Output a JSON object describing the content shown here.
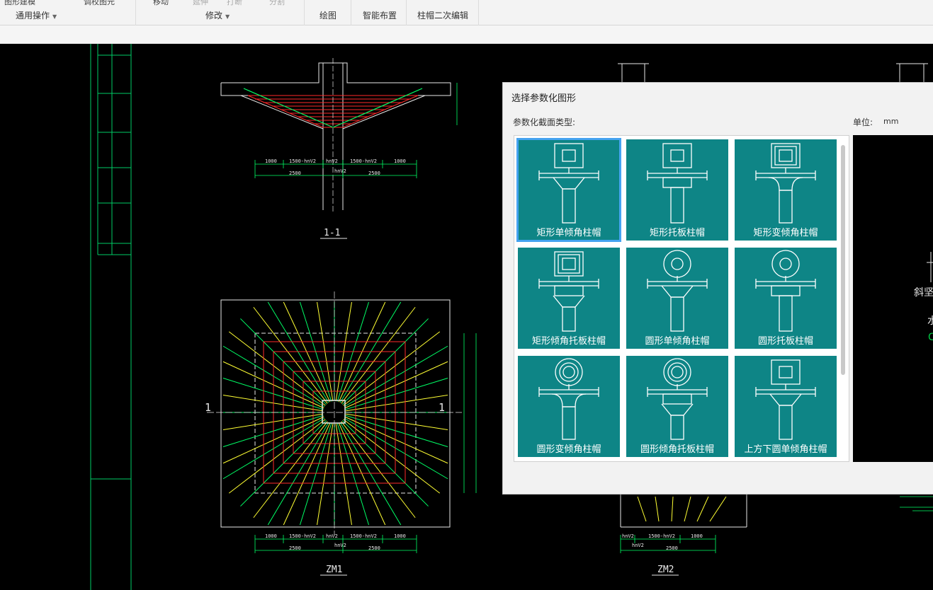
{
  "ribbon": {
    "top_items": [
      "图形建模",
      "调校图元",
      "移动",
      "延伸",
      "打断",
      "分割"
    ],
    "groups": [
      {
        "label": "通用操作",
        "has_dropdown": true
      },
      {
        "label": "修改",
        "has_dropdown": true
      },
      {
        "label": "绘图",
        "has_dropdown": false
      },
      {
        "label": "智能布置",
        "has_dropdown": false
      },
      {
        "label": "柱帽二次编辑",
        "has_dropdown": false
      }
    ],
    "dropdown_icon": "caret-down-icon"
  },
  "drawing": {
    "section_label": "1-1",
    "plan_label_1": "ZM1",
    "plan_label_2": "ZM2",
    "cut_marker": "1",
    "section_dims": [
      "1000",
      "1500-hnV2",
      "hnV2",
      "1500-hnV2",
      "1000"
    ],
    "section_totals": [
      "2500",
      "hnV2",
      "2500"
    ],
    "plan_dims": [
      "1000",
      "1500-hnV2",
      "hnV2",
      "1500-hnV2",
      "1000"
    ],
    "plan_totals": [
      "2500",
      "hnV2",
      "2500"
    ],
    "plan2_dims": [
      "hnV2",
      "1500-hnV2",
      "1000"
    ],
    "plan2_totals": [
      "hnV2",
      "2500"
    ],
    "colors": {
      "lines": "#e8e8e8",
      "green": "#00ff66",
      "red": "#ff2a2a",
      "yellow": "#ffff33"
    }
  },
  "dialog": {
    "title": "选择参数化图形",
    "type_label": "参数化截面类型:",
    "unit_label": "单位:",
    "unit_value": "mm",
    "tiles": [
      {
        "label": "矩形单倾角柱帽",
        "top": "square",
        "shelf": "none",
        "neck": "taper",
        "selected": true
      },
      {
        "label": "矩形托板柱帽",
        "top": "square",
        "shelf": "rect",
        "neck": "none",
        "selected": false
      },
      {
        "label": "矩形变倾角柱帽",
        "top": "square-double",
        "shelf": "none",
        "neck": "curve",
        "selected": false
      },
      {
        "label": "矩形倾角托板柱帽",
        "top": "square-double",
        "shelf": "rect",
        "neck": "taper",
        "selected": false
      },
      {
        "label": "圆形单倾角柱帽",
        "top": "circle",
        "shelf": "none",
        "neck": "taper",
        "selected": false
      },
      {
        "label": "圆形托板柱帽",
        "top": "circle",
        "shelf": "rect",
        "neck": "none",
        "selected": false
      },
      {
        "label": "圆形变倾角柱帽",
        "top": "circle-double",
        "shelf": "none",
        "neck": "curve",
        "selected": false
      },
      {
        "label": "圆形倾角托板柱帽",
        "top": "circle-double",
        "shelf": "rect",
        "neck": "taper",
        "selected": false
      },
      {
        "label": "上方下圆单倾角柱帽",
        "top": "square-circle",
        "shelf": "none",
        "neck": "taper",
        "selected": false
      }
    ],
    "preview": {
      "label_1": "斜坚",
      "label_2": "水",
      "label_3": "C",
      "label_3_color": "#00cc44"
    }
  }
}
